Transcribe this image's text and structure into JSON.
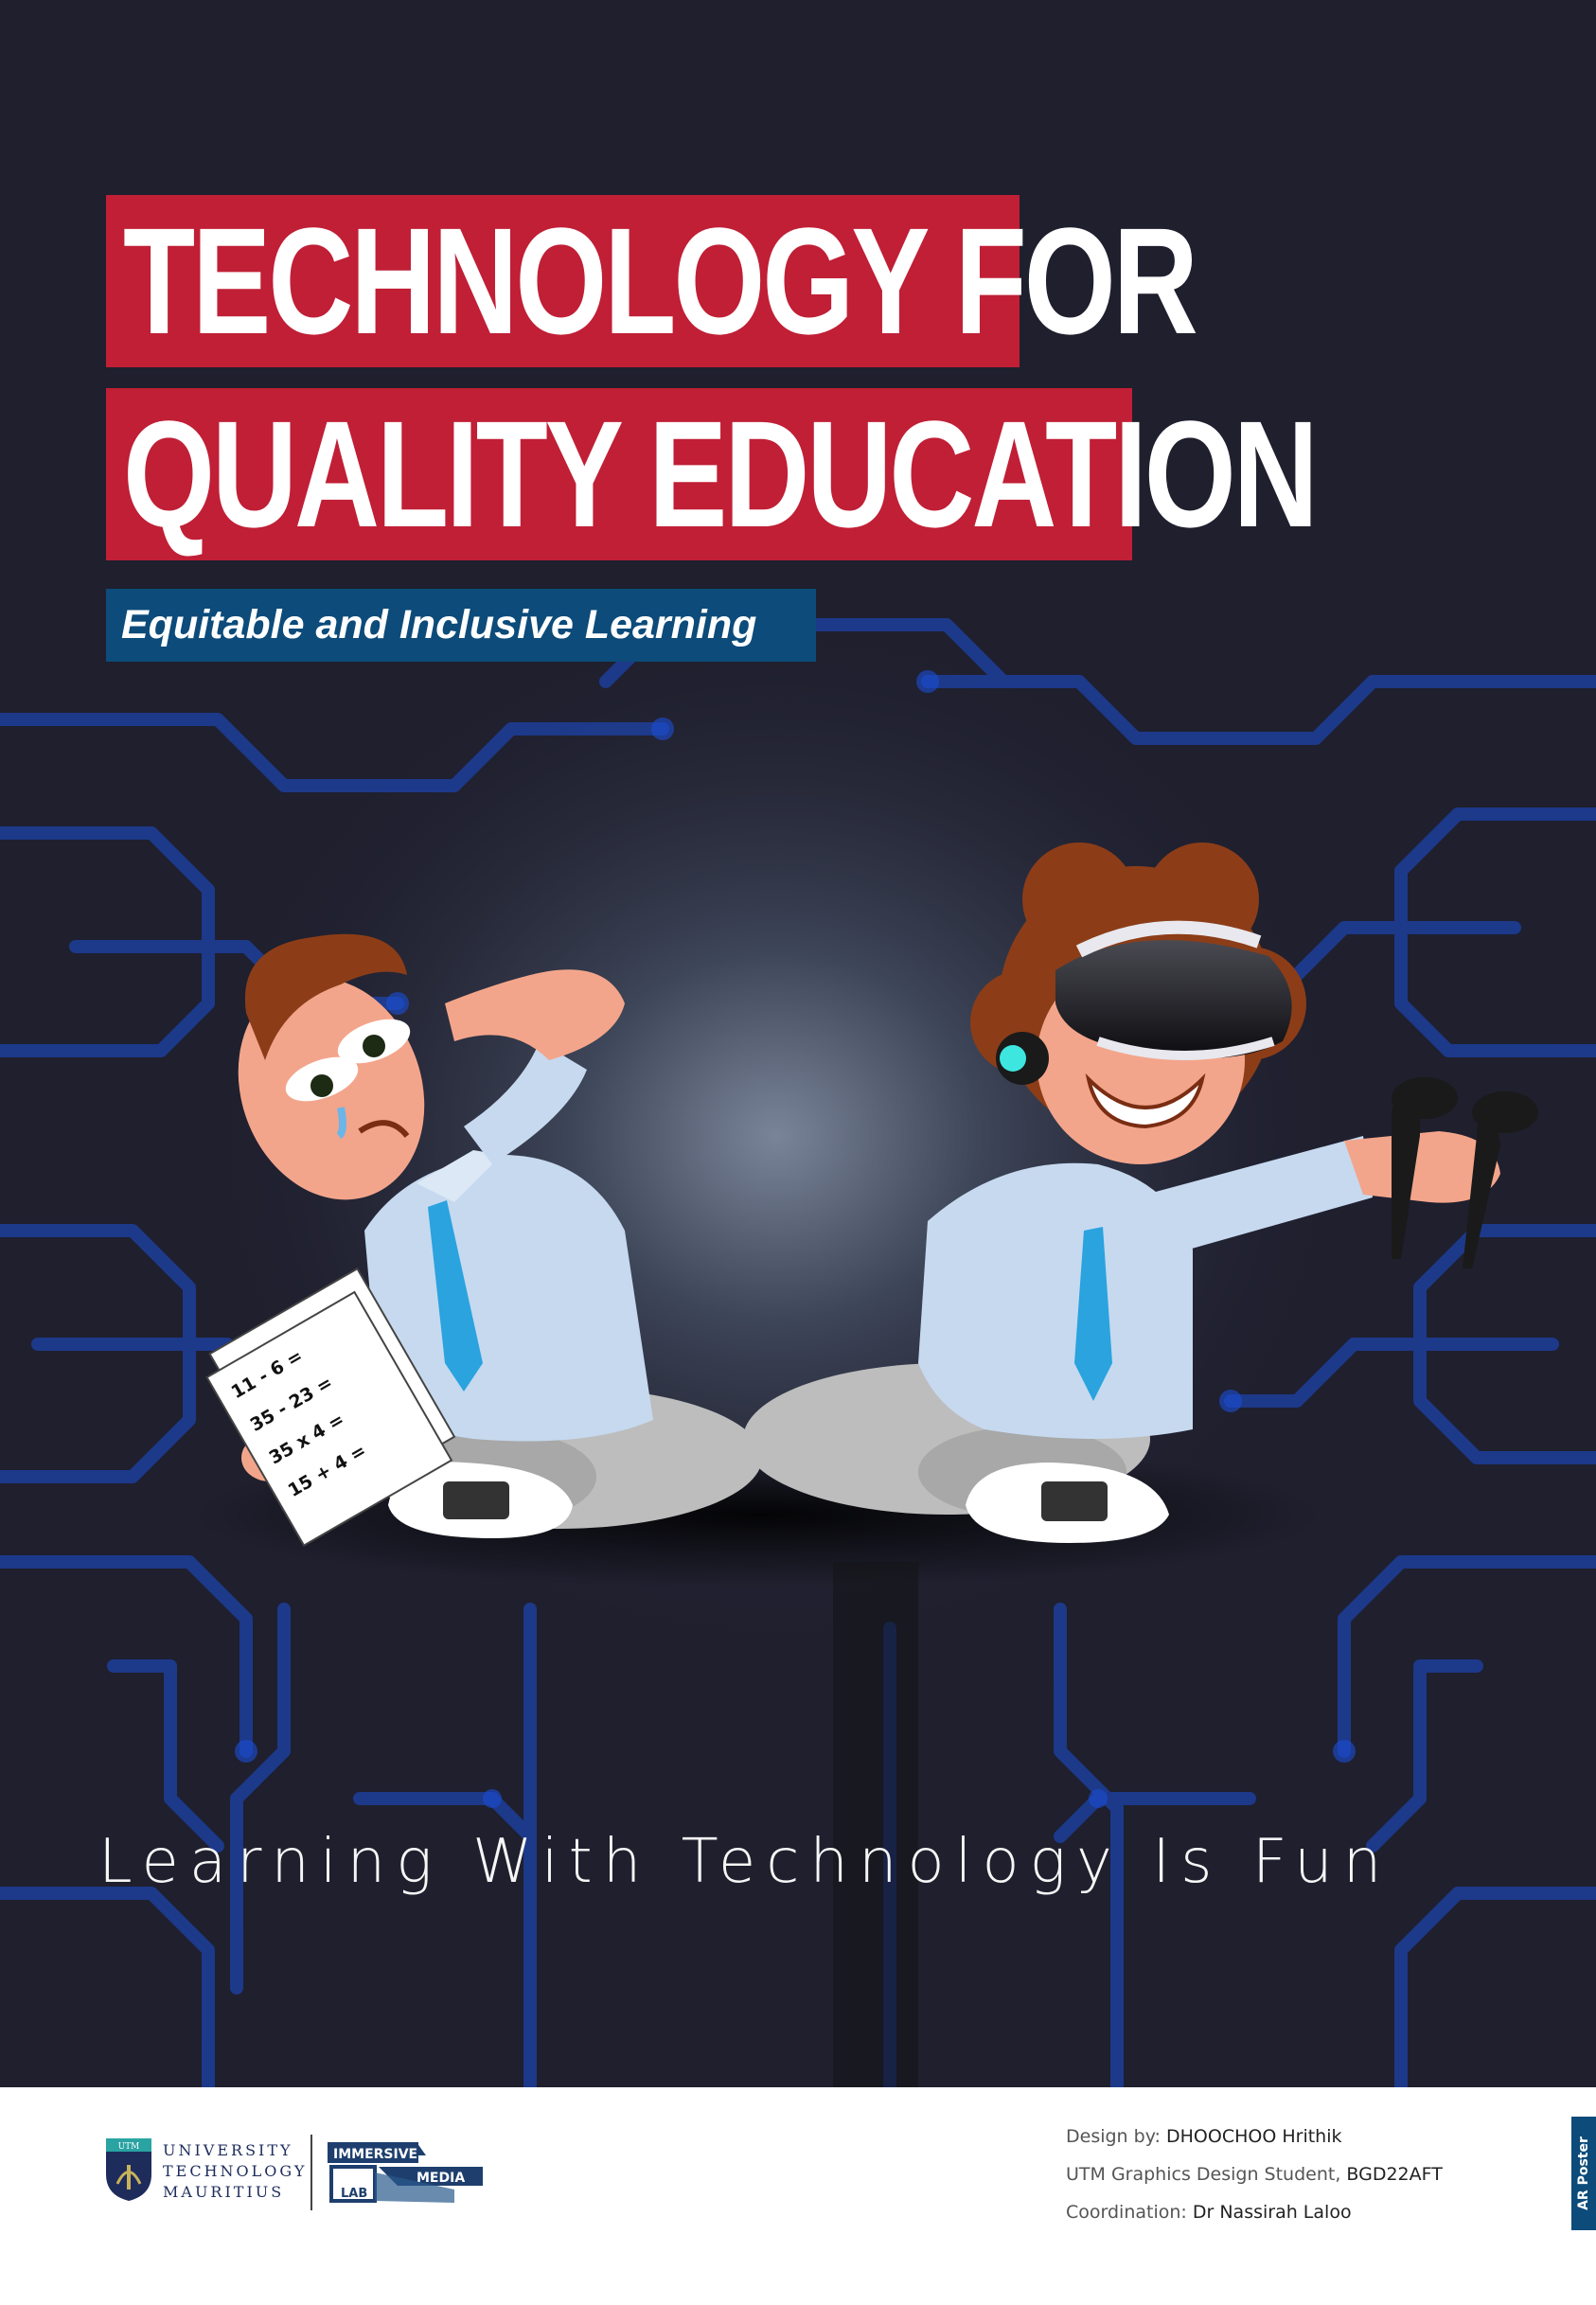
{
  "title": {
    "line1": "TECHNOLOGY FOR",
    "line2": "QUALITY EDUCATION"
  },
  "subtitle": "Equitable and Inclusive Learning",
  "worksheet": {
    "lines": [
      "11 - 6 =",
      "35 - 23 =",
      "35 x 4 =",
      "15 + 4 ="
    ]
  },
  "tagline": "Learning With Technology Is Fun",
  "footer": {
    "university": {
      "badge": "UTM",
      "name_lines": [
        "UNIVERSITY",
        "TECHNOLOGY",
        "MAURITIUS"
      ]
    },
    "lab_logo": {
      "words": [
        "IMMERSIVE",
        "MEDIA",
        "LAB"
      ]
    },
    "credits": {
      "design_prefix": "Design by: ",
      "design_name": "DHOOCHOO  Hrithik",
      "role_prefix": "UTM Graphics Design Student, ",
      "role_code": "BGD22AFT",
      "coord_prefix": "Coordination: ",
      "coord_name": "Dr Nassirah Laloo"
    },
    "tab_label": "AR Poster"
  },
  "colors": {
    "title_bg": "#c01f36",
    "subtitle_bg": "#0c4b7a",
    "background": "#1f1f2e",
    "circuit_blue": "#1b4fd6"
  }
}
